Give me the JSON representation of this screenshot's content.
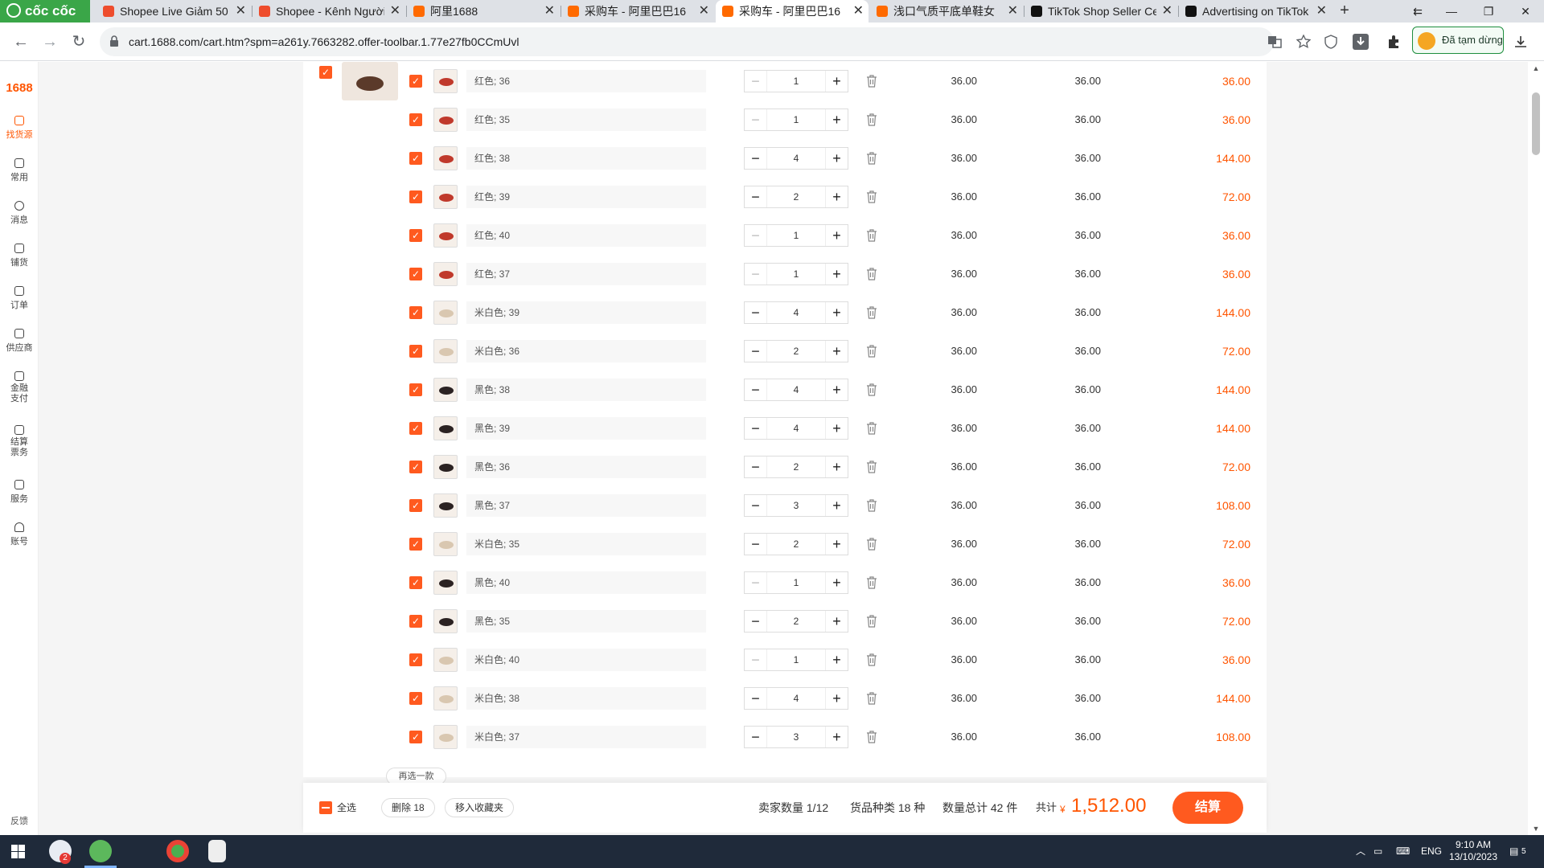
{
  "browser": {
    "brand": "cốc cốc",
    "tabs": [
      {
        "title": "Shopee Live Giảm 50",
        "active": false
      },
      {
        "title": "Shopee - Kênh Người",
        "active": false
      },
      {
        "title": "阿里1688",
        "active": false
      },
      {
        "title": "采购车 - 阿里巴巴16",
        "active": false
      },
      {
        "title": "采购车 - 阿里巴巴16",
        "active": true
      },
      {
        "title": "浅口气质平底单鞋女",
        "active": false
      },
      {
        "title": "TikTok Shop Seller Ce",
        "active": false
      },
      {
        "title": "Advertising on TikTok",
        "active": false
      }
    ],
    "url": "cart.1688.com/cart.htm?spm=a261y.7663282.offer-toolbar.1.77e27fb0CCmUvl",
    "profile_status": "Đã tạm dừng"
  },
  "sidebar": {
    "logo": "1688",
    "items": [
      {
        "label": "找货源",
        "active": true
      },
      {
        "label": "常用",
        "active": false
      },
      {
        "label": "消息",
        "active": false
      },
      {
        "label": "铺货",
        "active": false
      },
      {
        "label": "订单",
        "active": false
      },
      {
        "label": "供应商",
        "active": false
      },
      {
        "label": "金融支付",
        "active": false
      },
      {
        "label": "结算票务",
        "active": false
      },
      {
        "label": "服务",
        "active": false
      },
      {
        "label": "账号",
        "active": false
      }
    ],
    "feedback": "反馈"
  },
  "cart": {
    "rows": [
      {
        "spec": "红色; 36",
        "qty": "1",
        "price": "36.00",
        "unit": "36.00",
        "subtotal": "36.00",
        "color": "red"
      },
      {
        "spec": "红色; 35",
        "qty": "1",
        "price": "36.00",
        "unit": "36.00",
        "subtotal": "36.00",
        "color": "red"
      },
      {
        "spec": "红色; 38",
        "qty": "4",
        "price": "36.00",
        "unit": "36.00",
        "subtotal": "144.00",
        "color": "red"
      },
      {
        "spec": "红色; 39",
        "qty": "2",
        "price": "36.00",
        "unit": "36.00",
        "subtotal": "72.00",
        "color": "red"
      },
      {
        "spec": "红色; 40",
        "qty": "1",
        "price": "36.00",
        "unit": "36.00",
        "subtotal": "36.00",
        "color": "red"
      },
      {
        "spec": "红色; 37",
        "qty": "1",
        "price": "36.00",
        "unit": "36.00",
        "subtotal": "36.00",
        "color": "red"
      },
      {
        "spec": "米白色; 39",
        "qty": "4",
        "price": "36.00",
        "unit": "36.00",
        "subtotal": "144.00",
        "color": "beige"
      },
      {
        "spec": "米白色; 36",
        "qty": "2",
        "price": "36.00",
        "unit": "36.00",
        "subtotal": "72.00",
        "color": "beige"
      },
      {
        "spec": "黑色; 38",
        "qty": "4",
        "price": "36.00",
        "unit": "36.00",
        "subtotal": "144.00",
        "color": "black"
      },
      {
        "spec": "黑色; 39",
        "qty": "4",
        "price": "36.00",
        "unit": "36.00",
        "subtotal": "144.00",
        "color": "black"
      },
      {
        "spec": "黑色; 36",
        "qty": "2",
        "price": "36.00",
        "unit": "36.00",
        "subtotal": "72.00",
        "color": "black"
      },
      {
        "spec": "黑色; 37",
        "qty": "3",
        "price": "36.00",
        "unit": "36.00",
        "subtotal": "108.00",
        "color": "black"
      },
      {
        "spec": "米白色; 35",
        "qty": "2",
        "price": "36.00",
        "unit": "36.00",
        "subtotal": "72.00",
        "color": "beige"
      },
      {
        "spec": "黑色; 40",
        "qty": "1",
        "price": "36.00",
        "unit": "36.00",
        "subtotal": "36.00",
        "color": "black"
      },
      {
        "spec": "黑色; 35",
        "qty": "2",
        "price": "36.00",
        "unit": "36.00",
        "subtotal": "72.00",
        "color": "black"
      },
      {
        "spec": "米白色; 40",
        "qty": "1",
        "price": "36.00",
        "unit": "36.00",
        "subtotal": "36.00",
        "color": "beige"
      },
      {
        "spec": "米白色; 38",
        "qty": "4",
        "price": "36.00",
        "unit": "36.00",
        "subtotal": "144.00",
        "color": "beige"
      },
      {
        "spec": "米白色; 37",
        "qty": "3",
        "price": "36.00",
        "unit": "36.00",
        "subtotal": "108.00",
        "color": "beige"
      }
    ],
    "more_label": "再选一款"
  },
  "footer": {
    "select_all": "全选",
    "delete": "删除 18",
    "move_fav": "移入收藏夹",
    "sellers": "卖家数量 1/12",
    "kinds": "货品种类 18 种",
    "quantity": "数量总计 42 件",
    "total_label": "共计",
    "currency": "¥",
    "total": "1,512.00",
    "checkout": "结算"
  },
  "taskbar": {
    "lang": "ENG",
    "time": "9:10 AM",
    "date": "13/10/2023",
    "notif_count": "5",
    "badge": "2"
  },
  "colors": {
    "accent": "#ff5a1f",
    "price": "#ff5500",
    "red_shoe": "#c0392b",
    "beige_shoe": "#d9c7b0",
    "black_shoe": "#2b2222"
  }
}
